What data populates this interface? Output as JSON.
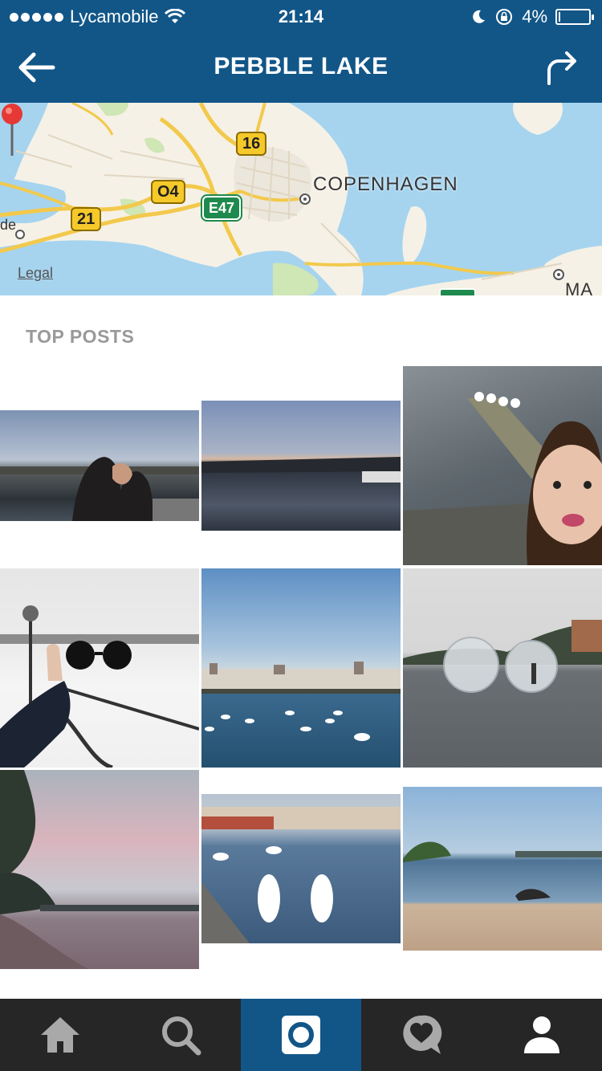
{
  "status_bar": {
    "carrier": "Lycamobile",
    "time": "21:14",
    "battery_text": "4%",
    "battery_level": 0.04
  },
  "header": {
    "title": "PEBBLE LAKE"
  },
  "map": {
    "city_label": "COPENHAGEN",
    "legal_label": "Legal",
    "road_labels": [
      "16",
      "O4",
      "21",
      "E47"
    ]
  },
  "section": {
    "title": "TOP POSTS"
  },
  "posts": [
    {
      "description": "couple by lake"
    },
    {
      "description": "lake at dusk"
    },
    {
      "description": "selfie by pier with swans"
    },
    {
      "description": "sunglasses in snow"
    },
    {
      "description": "swans in front of buildings"
    },
    {
      "description": "water balls on lake"
    },
    {
      "description": "pink sky over lake"
    },
    {
      "description": "swans at quay"
    },
    {
      "description": "person on shore"
    }
  ],
  "tabbar": {
    "items": [
      "home",
      "search",
      "camera",
      "activity",
      "profile"
    ],
    "active": "camera"
  },
  "colors": {
    "brand": "#125688",
    "tabbar": "#262626"
  }
}
